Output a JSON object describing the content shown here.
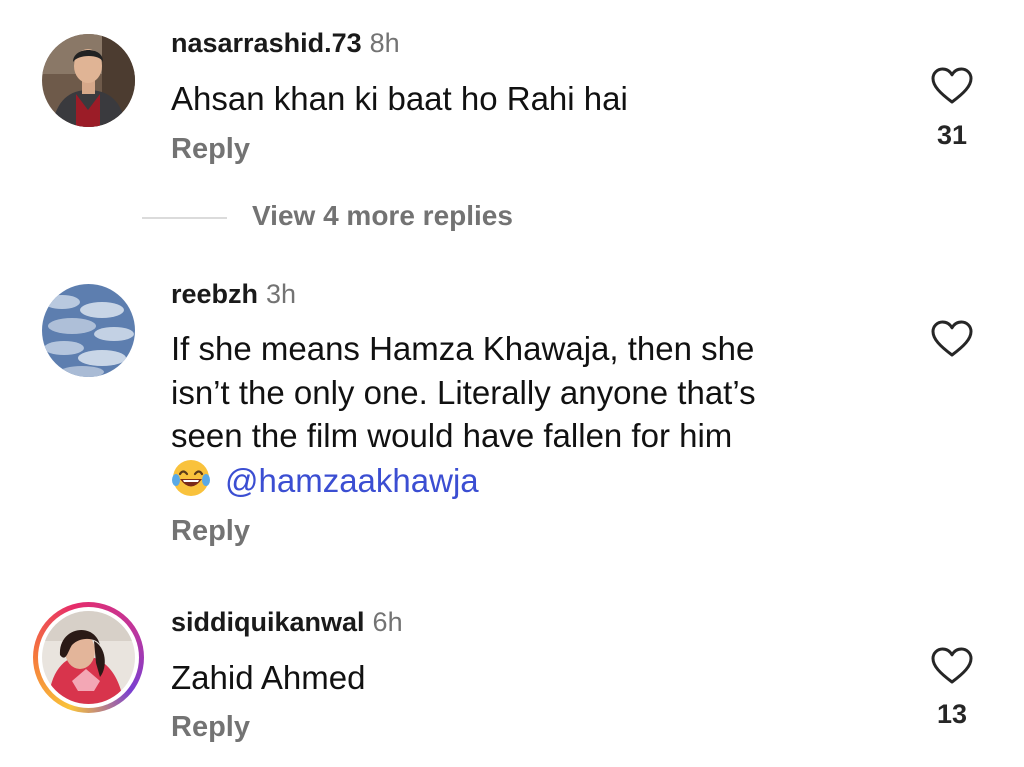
{
  "comments": [
    {
      "username": "nasarrashid.73",
      "time": "8h",
      "text_lines": [
        "Ahsan khan ki baat ho Rahi hai"
      ],
      "reply_label": "Reply",
      "likes": "31",
      "avatar_icon": "profile-photo-man-in-suit"
    },
    {
      "username": "reebzh",
      "time": "3h",
      "text_lines": [
        "If she means Hamza Khawaja, then she",
        "isn’t the only one. Literally anyone that’s",
        "seen the film would have fallen for him"
      ],
      "emoji": "😂",
      "mention": "@hamzaakhawja",
      "reply_label": "Reply",
      "likes": "",
      "avatar_icon": "profile-photo-cloudy-sky"
    },
    {
      "username": "siddiquikanwal",
      "time": "6h",
      "text_lines": [
        "Zahid Ahmed"
      ],
      "reply_label": "Reply",
      "likes": "13",
      "avatar_icon": "profile-photo-woman-with-story-ring"
    }
  ],
  "view_more_replies": "View 4 more replies",
  "colors": {
    "mention": "#3b4ed2",
    "secondary_text": "#737373",
    "primary_text": "#111111",
    "story_ring": [
      "#f9c43a",
      "#e62c6a",
      "#7a3fd1"
    ]
  }
}
